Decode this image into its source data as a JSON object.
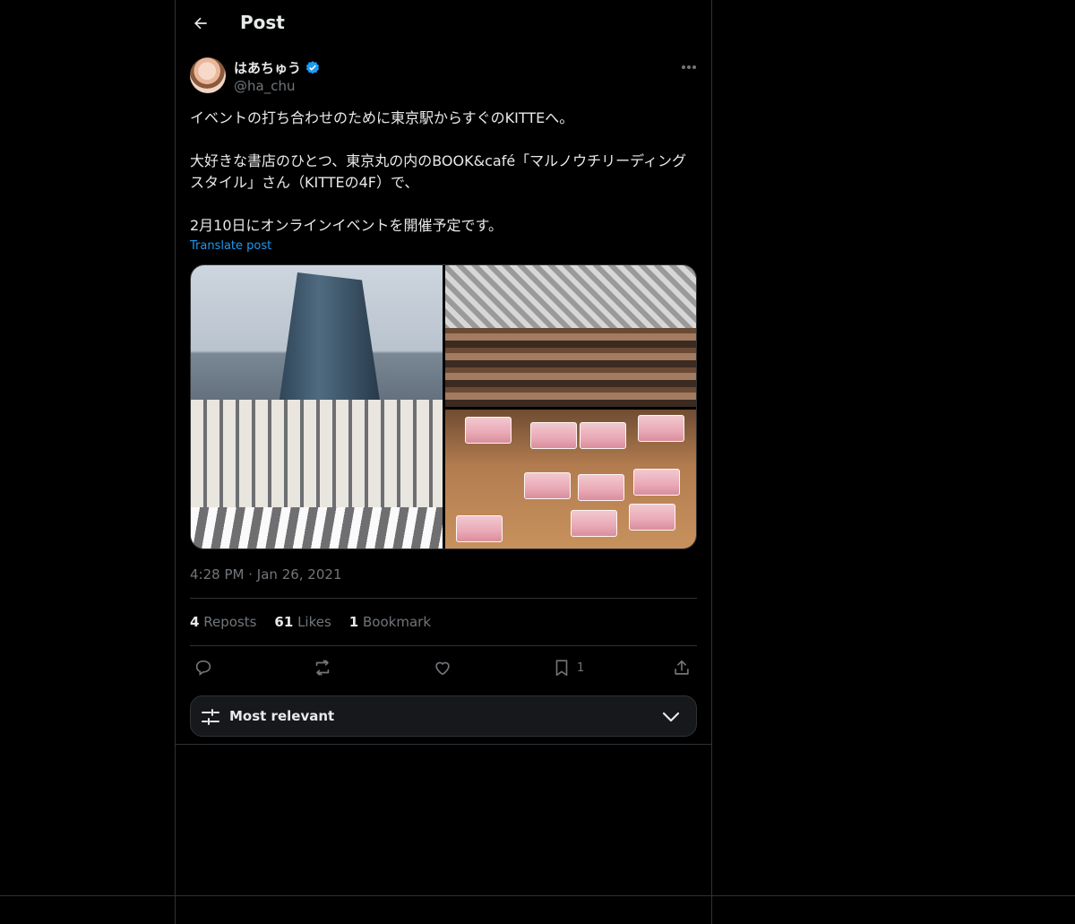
{
  "header": {
    "title": "Post"
  },
  "author": {
    "display_name": "はあちゅう",
    "handle": "@ha_chu",
    "verified": true
  },
  "post": {
    "text": "イベントの打ち合わせのために東京駅からすぐのKITTEへ。\n\n大好きな書店のひとつ、東京丸の内のBOOK&café「マルノウチリーディングスタイル」さん（KITTEの4F）で、\n\n2月10日にオンラインイベントを開催予定です。",
    "translate_label": "Translate post",
    "time": "4:28 PM",
    "separator": "·",
    "date": "Jan 26, 2021"
  },
  "stats": {
    "reposts_count": "4",
    "reposts_label": "Reposts",
    "likes_count": "61",
    "likes_label": "Likes",
    "bookmarks_count": "1",
    "bookmarks_label": "Bookmark"
  },
  "actions": {
    "bookmark_count": "1"
  },
  "sort": {
    "label": "Most relevant"
  },
  "colors": {
    "background": "#000000",
    "text": "#e7e9ea",
    "muted": "#71767b",
    "accent": "#1d9bf0",
    "border": "#2f3336"
  },
  "icons": [
    "back-arrow-icon",
    "verified-badge-icon",
    "more-icon",
    "reply-icon",
    "repost-icon",
    "like-icon",
    "bookmark-icon",
    "share-icon",
    "sliders-icon",
    "chevron-down-icon"
  ]
}
